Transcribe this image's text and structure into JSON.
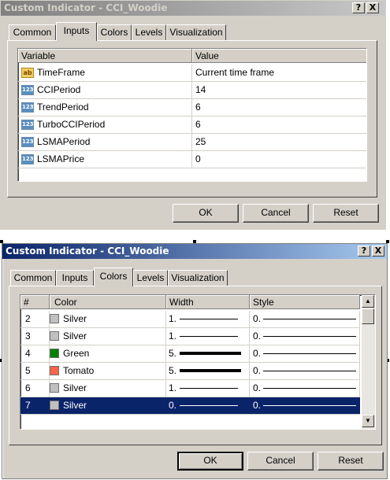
{
  "dialog1": {
    "title": "Custom Indicator - CCI_Woodie",
    "help_label": "?",
    "close_label": "X",
    "tabs": [
      "Common",
      "Inputs",
      "Colors",
      "Levels",
      "Visualization"
    ],
    "selected_tab": "Inputs",
    "columns": [
      "Variable",
      "Value"
    ],
    "rows": [
      {
        "type_icon": "ab",
        "variable": "TimeFrame",
        "value": "Current time frame"
      },
      {
        "type_icon": "123",
        "variable": "CCIPeriod",
        "value": "14"
      },
      {
        "type_icon": "123",
        "variable": "TrendPeriod",
        "value": "6"
      },
      {
        "type_icon": "123",
        "variable": "TurboCCIPeriod",
        "value": "6"
      },
      {
        "type_icon": "123",
        "variable": "LSMAPeriod",
        "value": "25"
      },
      {
        "type_icon": "123",
        "variable": "LSMAPrice",
        "value": "0"
      }
    ],
    "buttons": {
      "ok": "OK",
      "cancel": "Cancel",
      "reset": "Reset"
    }
  },
  "dialog2": {
    "title": "Custom Indicator - CCI_Woodie",
    "help_label": "?",
    "close_label": "X",
    "tabs": [
      "Common",
      "Inputs",
      "Colors",
      "Levels",
      "Visualization"
    ],
    "selected_tab": "Colors",
    "columns": [
      "#",
      "Color",
      "Width",
      "Style"
    ],
    "rows": [
      {
        "index": "2",
        "color_name": "Silver",
        "color_hex": "#c0c0c0",
        "width": "1.",
        "style": "0."
      },
      {
        "index": "3",
        "color_name": "Silver",
        "color_hex": "#c0c0c0",
        "width": "1.",
        "style": "0."
      },
      {
        "index": "4",
        "color_name": "Green",
        "color_hex": "#008000",
        "width": "5.",
        "style": "0."
      },
      {
        "index": "5",
        "color_name": "Tomato",
        "color_hex": "#ff6347",
        "width": "5.",
        "style": "0."
      },
      {
        "index": "6",
        "color_name": "Silver",
        "color_hex": "#c0c0c0",
        "width": "1.",
        "style": "0."
      },
      {
        "index": "7",
        "color_name": "Silver",
        "color_hex": "#c0c0c0",
        "width": "0.",
        "style": "0."
      }
    ],
    "selected_row_index": "7",
    "buttons": {
      "ok": "OK",
      "cancel": "Cancel",
      "reset": "Reset"
    }
  },
  "colors": {
    "dialog_face": "#d4d0c8",
    "active_title": "#0a246a",
    "selection": "#0a246a"
  }
}
